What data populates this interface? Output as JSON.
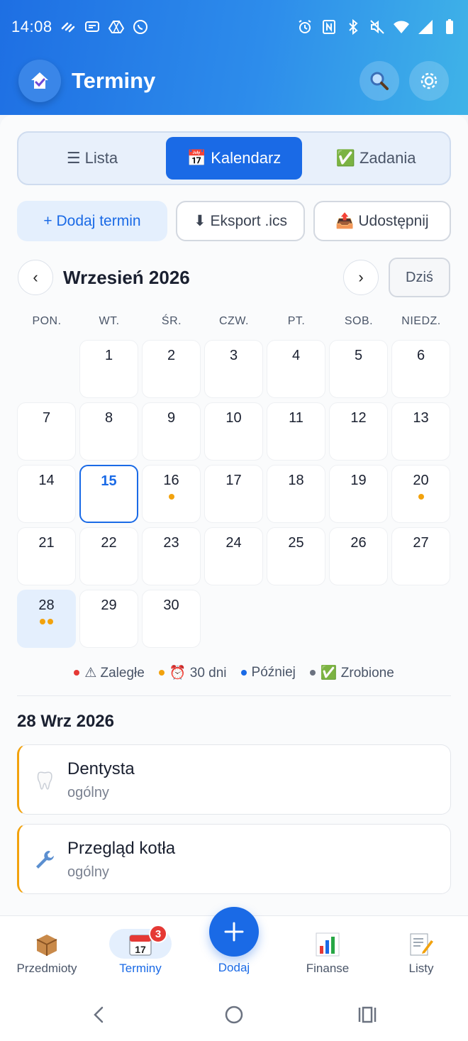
{
  "status_bar": {
    "time": "14:08"
  },
  "app_bar": {
    "title": "Terminy",
    "search_icon": "search-icon",
    "settings_icon": "gear-icon"
  },
  "view_switcher": {
    "items": [
      {
        "label": "☰ Lista",
        "active": false
      },
      {
        "label": "📅 Kalendarz",
        "active": true
      },
      {
        "label": "✅ Zadania",
        "active": false
      }
    ]
  },
  "actions": {
    "add": "+ Dodaj termin",
    "export": "⬇ Eksport .ics",
    "share": "📤  Udostępnij"
  },
  "calendar": {
    "month_title": "Wrzesień 2026",
    "prev_label": "‹",
    "next_label": "›",
    "today_label": "Dziś",
    "weekdays": [
      "PON.",
      "WT.",
      "ŚR.",
      "CZW.",
      "PT.",
      "SOB.",
      "NIEDZ."
    ],
    "days": [
      {
        "n": "1"
      },
      {
        "n": "2"
      },
      {
        "n": "3"
      },
      {
        "n": "4"
      },
      {
        "n": "5"
      },
      {
        "n": "6"
      },
      {
        "n": "7"
      },
      {
        "n": "8"
      },
      {
        "n": "9"
      },
      {
        "n": "10"
      },
      {
        "n": "11"
      },
      {
        "n": "12"
      },
      {
        "n": "13"
      },
      {
        "n": "14"
      },
      {
        "n": "15",
        "today": true
      },
      {
        "n": "16",
        "dots": 1
      },
      {
        "n": "17"
      },
      {
        "n": "18"
      },
      {
        "n": "19"
      },
      {
        "n": "20",
        "dots": 1
      },
      {
        "n": "21"
      },
      {
        "n": "22"
      },
      {
        "n": "23"
      },
      {
        "n": "24"
      },
      {
        "n": "25"
      },
      {
        "n": "26"
      },
      {
        "n": "27"
      },
      {
        "n": "28",
        "dots": 2,
        "selected": true
      },
      {
        "n": "29"
      },
      {
        "n": "30"
      }
    ],
    "first_weekday_offset": 1,
    "dot_color": "#f2a20d"
  },
  "legend": [
    {
      "label": "⚠ Zaległe",
      "color": "#e53935"
    },
    {
      "label": "⏰ 30 dni",
      "color": "#f2a20d"
    },
    {
      "label": "Później",
      "color": "#1a6ae6"
    },
    {
      "label": "✅ Zrobione",
      "color": "#6b7280"
    }
  ],
  "events_section": {
    "date_heading": "28 Wrz 2026",
    "events": [
      {
        "title": "Dentysta",
        "category": "ogólny",
        "icon": "tooth-icon"
      },
      {
        "title": "Przegląd kotła",
        "category": "ogólny",
        "icon": "wrench-icon"
      }
    ]
  },
  "bottom_nav": {
    "items": [
      {
        "label": "Przedmioty",
        "icon": "package-icon"
      },
      {
        "label": "Terminy",
        "icon": "calendar-icon",
        "active": true,
        "badge": "3"
      },
      {
        "label": "Dodaj",
        "icon": "plus-icon"
      },
      {
        "label": "Finanse",
        "icon": "bar-chart-icon"
      },
      {
        "label": "Listy",
        "icon": "memo-icon"
      }
    ]
  },
  "colors": {
    "accent": "#1a6ae6",
    "header_gradient_start": "#1e6fe3",
    "header_gradient_end": "#3fb3e8",
    "upcoming": "#f2a20d"
  }
}
